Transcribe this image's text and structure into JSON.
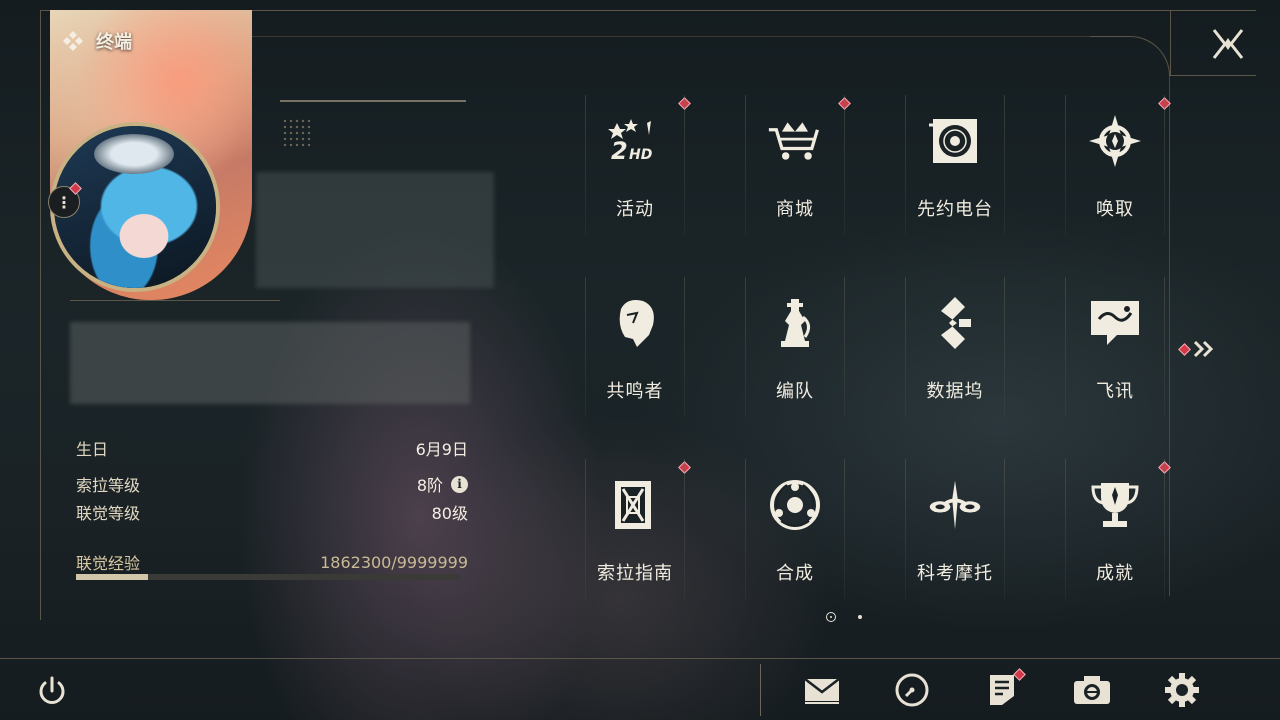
{
  "header": {
    "title": "终端"
  },
  "profile": {
    "birthday_label": "生日",
    "birthday_value": "6月9日",
    "sola_level_label": "索拉等级",
    "sola_level_value": "8阶",
    "union_level_label": "联觉等级",
    "union_level_value": "80级",
    "union_exp_label": "联觉经验",
    "union_exp_value": "1862300/9999999",
    "union_exp_fraction": 0.1862
  },
  "menu": {
    "items": [
      {
        "label": "活动",
        "icon": "events-2hd-icon",
        "badge": true
      },
      {
        "label": "商城",
        "icon": "shop-crown-cart-icon",
        "badge": true
      },
      {
        "label": "先约电台",
        "icon": "radio-record-icon",
        "badge": false
      },
      {
        "label": "唤取",
        "icon": "convene-compass-icon",
        "badge": true
      },
      {
        "label": "共鸣者",
        "icon": "resonator-profile-icon",
        "badge": false
      },
      {
        "label": "编队",
        "icon": "team-chess-icon",
        "badge": false
      },
      {
        "label": "数据坞",
        "icon": "data-bank-icon",
        "badge": false
      },
      {
        "label": "飞讯",
        "icon": "chat-message-icon",
        "badge": false
      },
      {
        "label": "索拉指南",
        "icon": "guidebook-icon",
        "badge": true
      },
      {
        "label": "合成",
        "icon": "synthesis-icon",
        "badge": false
      },
      {
        "label": "科考摩托",
        "icon": "motorcycle-icon",
        "badge": false
      },
      {
        "label": "成就",
        "icon": "trophy-icon",
        "badge": true
      }
    ],
    "page_count": 2,
    "current_page": 1
  },
  "bottom_bar": {
    "buttons": [
      {
        "icon": "mail-icon",
        "badge": false
      },
      {
        "icon": "clock-icon",
        "badge": false
      },
      {
        "icon": "notice-icon",
        "badge": true
      },
      {
        "icon": "camera-icon",
        "badge": false
      },
      {
        "icon": "settings-gear-icon",
        "badge": false
      }
    ]
  },
  "colors": {
    "accent": "#c8b284",
    "badge": "#d23a4a",
    "text": "#f1ece0"
  }
}
